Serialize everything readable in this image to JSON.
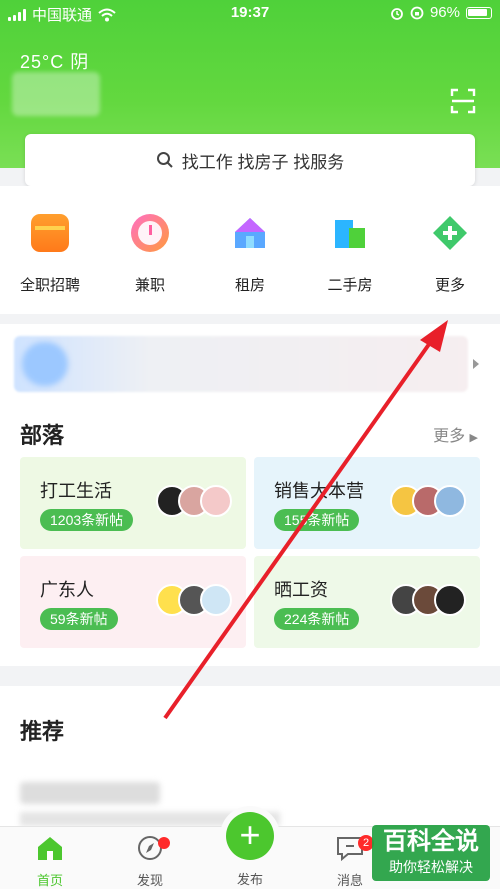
{
  "status_bar": {
    "carrier": "中国联通",
    "time": "19:37",
    "battery": "96%"
  },
  "header": {
    "weather": "25°C  阴"
  },
  "search": {
    "placeholder": "找工作 找房子 找服务"
  },
  "quick_links": [
    {
      "label": "全职招聘",
      "icon": "briefcase-icon"
    },
    {
      "label": "兼职",
      "icon": "clock-icon"
    },
    {
      "label": "租房",
      "icon": "house-icon"
    },
    {
      "label": "二手房",
      "icon": "building-icon"
    },
    {
      "label": "更多",
      "icon": "plus-diamond-icon"
    }
  ],
  "tribe": {
    "title": "部落",
    "more": "更多",
    "cards": [
      {
        "name": "打工生活",
        "tag": "1203条新帖"
      },
      {
        "name": "销售大本营",
        "tag": "155条新帖"
      },
      {
        "name": "广东人",
        "tag": "59条新帖"
      },
      {
        "name": "晒工资",
        "tag": "224条新帖"
      }
    ]
  },
  "recommend": {
    "title": "推荐"
  },
  "tabbar": {
    "home": "首页",
    "discover": "发现",
    "publish": "发布",
    "messages": "消息",
    "message_badge": "2"
  },
  "watermark": {
    "line1": "百科全说",
    "line2": "助你轻松解决"
  },
  "colors": {
    "brand_green": "#4fd13a",
    "tag_green": "#4bbd52",
    "badge_red": "#ff2a2a"
  }
}
